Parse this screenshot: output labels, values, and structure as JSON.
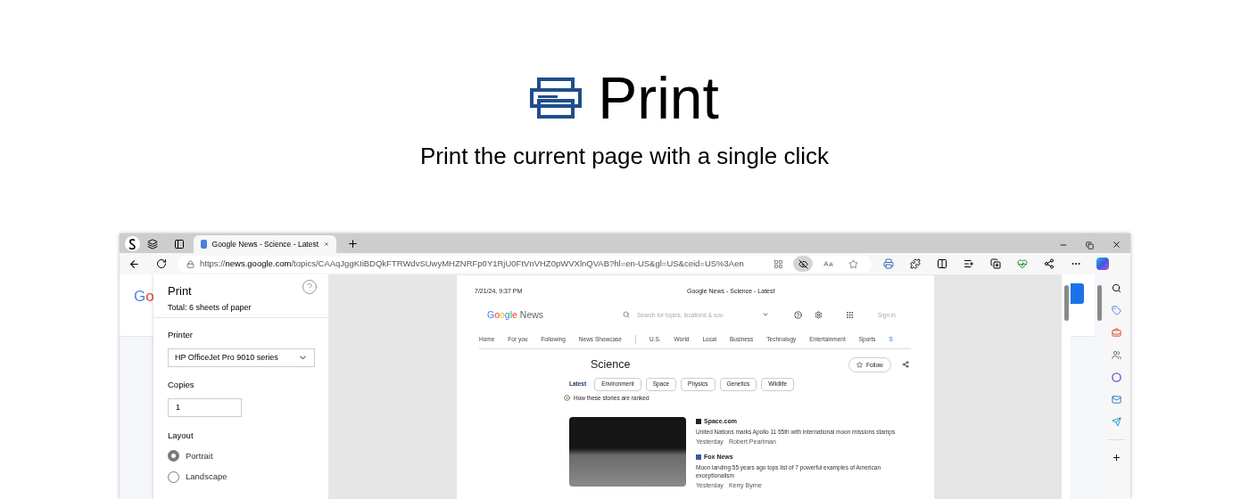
{
  "hero": {
    "title": "Print",
    "subtitle": "Print the current page with a single click"
  },
  "browser": {
    "tabs": [
      {
        "label": "Google News - Science - Latest",
        "selected": true
      }
    ],
    "url_prefix": "https://",
    "url_host": "news.google.com",
    "url_path": "/topics/CAAqJggKIiBDQkFTRWdvSUwyMHZNRFp0Y1RjU0FtVnVHZ0pWVXlnQVAB?hl=en-US&gl=US&ceid=US%3Aen",
    "background_logo": "Go"
  },
  "print_panel": {
    "title": "Print",
    "summary": "Total: 6 sheets of paper",
    "printer_label": "Printer",
    "printer": "HP OfficeJet Pro 9010 series",
    "copies_label": "Copies",
    "copies": "1",
    "layout_label": "Layout",
    "layout_options": [
      {
        "label": "Portrait",
        "selected": true
      },
      {
        "label": "Landscape",
        "selected": false
      }
    ]
  },
  "preview": {
    "date": "7/21/24, 9:37 PM",
    "page_title": "Google News - Science - Latest",
    "logo": "Google",
    "logo_suffix": "News",
    "search_placeholder": "Search for topics, locations & sou",
    "sign_in": "Sign in",
    "nav": [
      {
        "label": "Home",
        "selected": false
      },
      {
        "label": "For you",
        "selected": false
      },
      {
        "label": "Following",
        "selected": false
      },
      {
        "label": "News Showcase",
        "selected": false
      },
      {
        "label": "U.S.",
        "selected": false
      },
      {
        "label": "World",
        "selected": false
      },
      {
        "label": "Local",
        "selected": false
      },
      {
        "label": "Business",
        "selected": false
      },
      {
        "label": "Technology",
        "selected": false
      },
      {
        "label": "Entertainment",
        "selected": false
      },
      {
        "label": "Sports",
        "selected": false
      },
      {
        "label": "S",
        "selected": true
      }
    ],
    "topic": "Science",
    "follow": "Follow",
    "chips": [
      {
        "label": "Latest",
        "selected": true
      },
      {
        "label": "Environment",
        "selected": false
      },
      {
        "label": "Space",
        "selected": false
      },
      {
        "label": "Physics",
        "selected": false
      },
      {
        "label": "Genetics",
        "selected": false
      },
      {
        "label": "Wildlife",
        "selected": false
      }
    ],
    "ranking_note": "How these stories are ranked",
    "articles": [
      {
        "source": "Space.com",
        "title": "United Nations marks Apollo 11 55th with international moon missions stamps",
        "time": "Yesterday",
        "author": "Robert Pearlman"
      },
      {
        "source": "Fox News",
        "title": "Moon landing 55 years ago tops list of 7 powerful examples of American exceptionalism",
        "time": "Yesterday",
        "author": "Kerry Byrne"
      }
    ]
  }
}
